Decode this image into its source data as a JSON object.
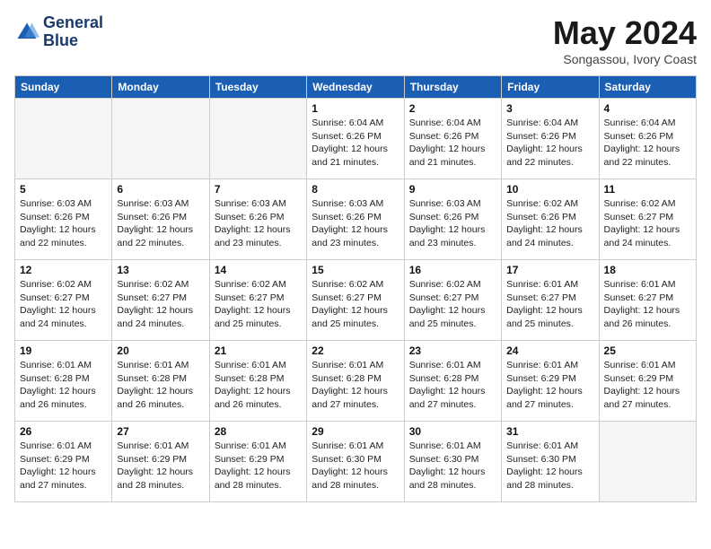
{
  "header": {
    "logo_line1": "General",
    "logo_line2": "Blue",
    "month_year": "May 2024",
    "location": "Songassou, Ivory Coast"
  },
  "days_of_week": [
    "Sunday",
    "Monday",
    "Tuesday",
    "Wednesday",
    "Thursday",
    "Friday",
    "Saturday"
  ],
  "weeks": [
    [
      {
        "day": "",
        "info": ""
      },
      {
        "day": "",
        "info": ""
      },
      {
        "day": "",
        "info": ""
      },
      {
        "day": "1",
        "info": "Sunrise: 6:04 AM\nSunset: 6:26 PM\nDaylight: 12 hours\nand 21 minutes."
      },
      {
        "day": "2",
        "info": "Sunrise: 6:04 AM\nSunset: 6:26 PM\nDaylight: 12 hours\nand 21 minutes."
      },
      {
        "day": "3",
        "info": "Sunrise: 6:04 AM\nSunset: 6:26 PM\nDaylight: 12 hours\nand 22 minutes."
      },
      {
        "day": "4",
        "info": "Sunrise: 6:04 AM\nSunset: 6:26 PM\nDaylight: 12 hours\nand 22 minutes."
      }
    ],
    [
      {
        "day": "5",
        "info": "Sunrise: 6:03 AM\nSunset: 6:26 PM\nDaylight: 12 hours\nand 22 minutes."
      },
      {
        "day": "6",
        "info": "Sunrise: 6:03 AM\nSunset: 6:26 PM\nDaylight: 12 hours\nand 22 minutes."
      },
      {
        "day": "7",
        "info": "Sunrise: 6:03 AM\nSunset: 6:26 PM\nDaylight: 12 hours\nand 23 minutes."
      },
      {
        "day": "8",
        "info": "Sunrise: 6:03 AM\nSunset: 6:26 PM\nDaylight: 12 hours\nand 23 minutes."
      },
      {
        "day": "9",
        "info": "Sunrise: 6:03 AM\nSunset: 6:26 PM\nDaylight: 12 hours\nand 23 minutes."
      },
      {
        "day": "10",
        "info": "Sunrise: 6:02 AM\nSunset: 6:26 PM\nDaylight: 12 hours\nand 24 minutes."
      },
      {
        "day": "11",
        "info": "Sunrise: 6:02 AM\nSunset: 6:27 PM\nDaylight: 12 hours\nand 24 minutes."
      }
    ],
    [
      {
        "day": "12",
        "info": "Sunrise: 6:02 AM\nSunset: 6:27 PM\nDaylight: 12 hours\nand 24 minutes."
      },
      {
        "day": "13",
        "info": "Sunrise: 6:02 AM\nSunset: 6:27 PM\nDaylight: 12 hours\nand 24 minutes."
      },
      {
        "day": "14",
        "info": "Sunrise: 6:02 AM\nSunset: 6:27 PM\nDaylight: 12 hours\nand 25 minutes."
      },
      {
        "day": "15",
        "info": "Sunrise: 6:02 AM\nSunset: 6:27 PM\nDaylight: 12 hours\nand 25 minutes."
      },
      {
        "day": "16",
        "info": "Sunrise: 6:02 AM\nSunset: 6:27 PM\nDaylight: 12 hours\nand 25 minutes."
      },
      {
        "day": "17",
        "info": "Sunrise: 6:01 AM\nSunset: 6:27 PM\nDaylight: 12 hours\nand 25 minutes."
      },
      {
        "day": "18",
        "info": "Sunrise: 6:01 AM\nSunset: 6:27 PM\nDaylight: 12 hours\nand 26 minutes."
      }
    ],
    [
      {
        "day": "19",
        "info": "Sunrise: 6:01 AM\nSunset: 6:28 PM\nDaylight: 12 hours\nand 26 minutes."
      },
      {
        "day": "20",
        "info": "Sunrise: 6:01 AM\nSunset: 6:28 PM\nDaylight: 12 hours\nand 26 minutes."
      },
      {
        "day": "21",
        "info": "Sunrise: 6:01 AM\nSunset: 6:28 PM\nDaylight: 12 hours\nand 26 minutes."
      },
      {
        "day": "22",
        "info": "Sunrise: 6:01 AM\nSunset: 6:28 PM\nDaylight: 12 hours\nand 27 minutes."
      },
      {
        "day": "23",
        "info": "Sunrise: 6:01 AM\nSunset: 6:28 PM\nDaylight: 12 hours\nand 27 minutes."
      },
      {
        "day": "24",
        "info": "Sunrise: 6:01 AM\nSunset: 6:29 PM\nDaylight: 12 hours\nand 27 minutes."
      },
      {
        "day": "25",
        "info": "Sunrise: 6:01 AM\nSunset: 6:29 PM\nDaylight: 12 hours\nand 27 minutes."
      }
    ],
    [
      {
        "day": "26",
        "info": "Sunrise: 6:01 AM\nSunset: 6:29 PM\nDaylight: 12 hours\nand 27 minutes."
      },
      {
        "day": "27",
        "info": "Sunrise: 6:01 AM\nSunset: 6:29 PM\nDaylight: 12 hours\nand 28 minutes."
      },
      {
        "day": "28",
        "info": "Sunrise: 6:01 AM\nSunset: 6:29 PM\nDaylight: 12 hours\nand 28 minutes."
      },
      {
        "day": "29",
        "info": "Sunrise: 6:01 AM\nSunset: 6:30 PM\nDaylight: 12 hours\nand 28 minutes."
      },
      {
        "day": "30",
        "info": "Sunrise: 6:01 AM\nSunset: 6:30 PM\nDaylight: 12 hours\nand 28 minutes."
      },
      {
        "day": "31",
        "info": "Sunrise: 6:01 AM\nSunset: 6:30 PM\nDaylight: 12 hours\nand 28 minutes."
      },
      {
        "day": "",
        "info": ""
      }
    ]
  ]
}
